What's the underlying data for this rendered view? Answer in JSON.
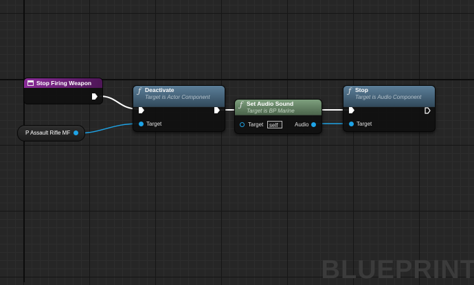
{
  "graph": {
    "watermark": "BLUEPRINT",
    "nodes": {
      "event_stop_firing": {
        "title": "Stop Firing Weapon",
        "icon": "event-icon"
      },
      "variable_rifle": {
        "label": "P Assault Rifle MF"
      },
      "deactivate": {
        "icon": "function-icon",
        "title": "Deactivate",
        "subtitle": "Target is Actor Component",
        "target_label": "Target"
      },
      "set_audio_sound": {
        "icon": "function-icon",
        "title": "Set Audio Sound",
        "subtitle": "Target is BP Marine",
        "target_label": "Target",
        "target_value": "self",
        "audio_label": "Audio"
      },
      "stop": {
        "icon": "function-icon",
        "title": "Stop",
        "subtitle": "Target is Audio Component",
        "target_label": "Target"
      }
    },
    "colors": {
      "background": "#262626",
      "exec_wire": "#ffffff",
      "data_wire": "#1ea3e6",
      "event_header": "#8a2c99",
      "function_header": "#4a6a82",
      "pure_header": "#6a8a6a"
    }
  }
}
